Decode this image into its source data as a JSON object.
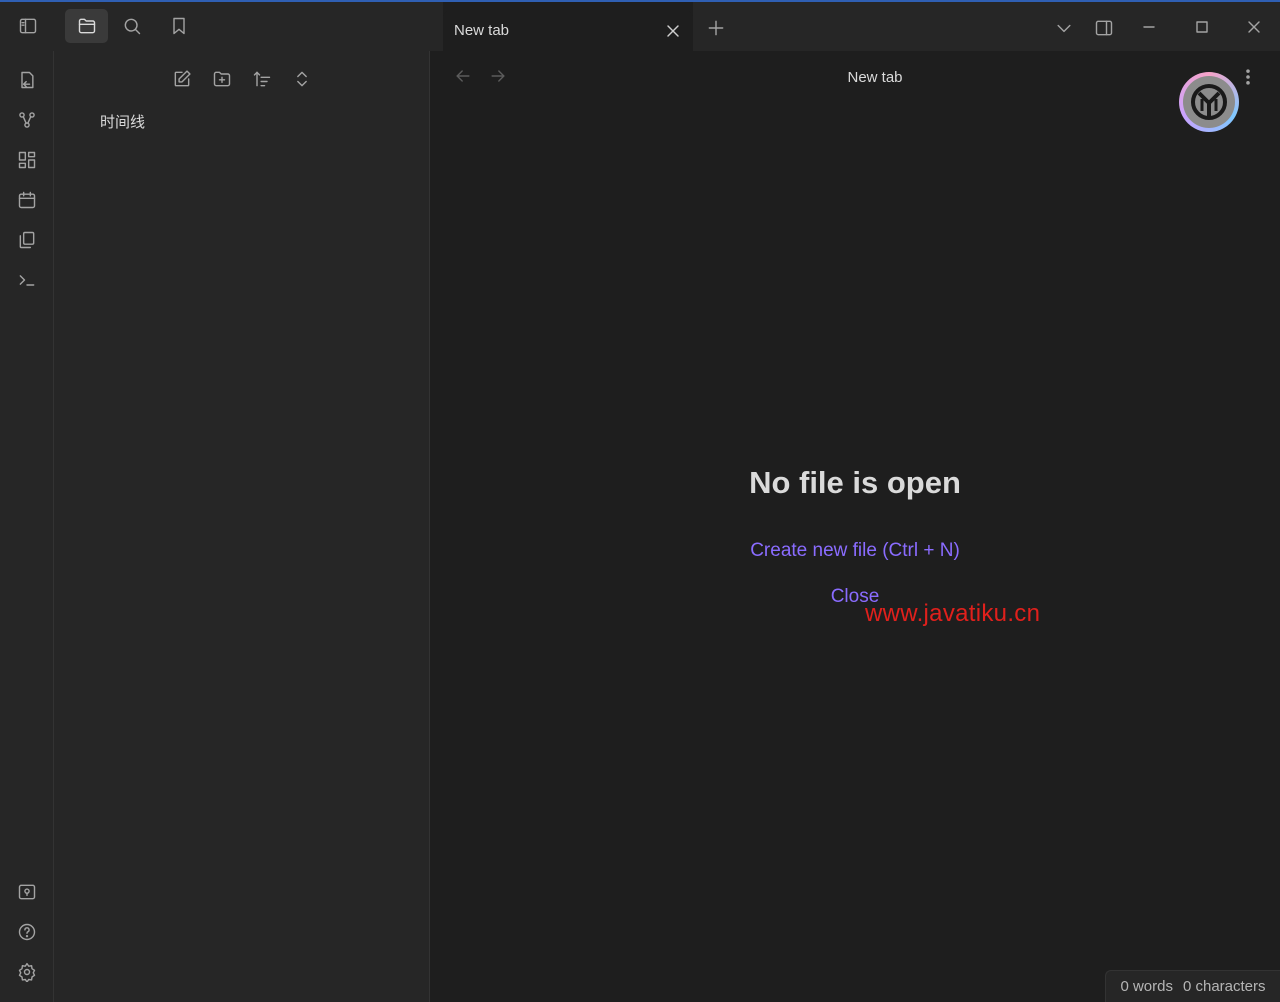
{
  "tab": {
    "title": "New tab"
  },
  "view": {
    "title": "New tab"
  },
  "sidebar": {
    "items": [
      {
        "label": "时间线"
      }
    ]
  },
  "empty_state": {
    "title": "No file is open",
    "create_label": "Create new file (Ctrl + N)",
    "close_label": "Close"
  },
  "watermark": "www.javatiku.cn",
  "status": {
    "words": "0 words",
    "characters": "0 characters"
  },
  "colors": {
    "accent": "#8a6cff",
    "watermark": "#e0201c",
    "titlebar_border": "#2f5fb3"
  },
  "icons": {
    "topbar": [
      "sidebar-toggle-icon",
      "folder-icon",
      "search-icon",
      "bookmark-icon"
    ],
    "sidebar_toolbar": [
      "new-note-icon",
      "new-folder-icon",
      "sort-icon",
      "expand-collapse-icon"
    ],
    "ribbon": [
      "switcher-icon",
      "graph-icon",
      "canvas-icon",
      "calendar-icon",
      "templates-icon",
      "terminal-icon"
    ],
    "ribbon_bottom": [
      "vault-icon",
      "help-icon",
      "settings-icon"
    ],
    "window": [
      "chevron-down-icon",
      "right-sidebar-icon",
      "minimize-icon",
      "maximize-icon",
      "close-icon"
    ]
  }
}
